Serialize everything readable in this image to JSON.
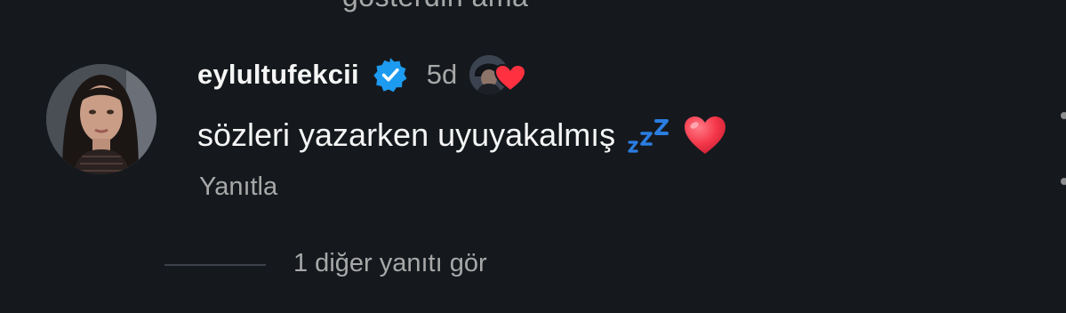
{
  "previous_comment": {
    "cut_text": "gösterdin ama"
  },
  "comment": {
    "username": "eylultufekcii",
    "verified": true,
    "time_ago": "5d",
    "text": "sözleri yazarken uyuyakalmış",
    "emojis": [
      "zzz-icon",
      "red-heart-icon"
    ],
    "reply_label": "Yanıtla"
  },
  "replies": {
    "view_more_label": "1 diğer yanıtı gör"
  },
  "colors": {
    "background": "#15191e",
    "primary_text": "#f5f5f5",
    "secondary_text": "#a8a8a8",
    "verified_blue": "#1d9bf0",
    "heart_red": "#ff3040",
    "zzz_blue": "#2a7de1"
  }
}
